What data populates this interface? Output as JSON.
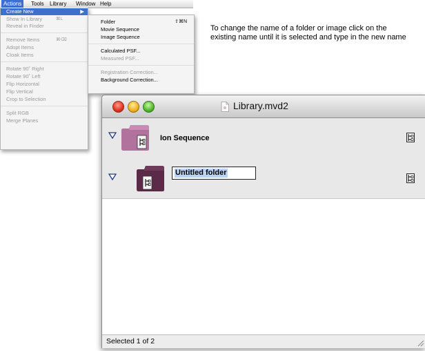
{
  "menubar": {
    "items": [
      {
        "label": "Actions",
        "active": true
      },
      {
        "label": "Tools"
      },
      {
        "label": "Library"
      },
      {
        "label": "Window"
      },
      {
        "label": "Help"
      }
    ]
  },
  "actions_menu": {
    "items": [
      {
        "label": "Create New",
        "highlighted": true,
        "arrow": "▶"
      },
      {
        "label": "Show In Library",
        "shortcut": "⌘L",
        "disabled": true
      },
      {
        "label": "Reveal in Finder",
        "disabled": true
      },
      {
        "label": "Remove Items",
        "shortcut": "⌘⌫",
        "disabled": true
      },
      {
        "label": "Adopt Items",
        "disabled": true
      },
      {
        "label": "Cloak Items",
        "disabled": true
      },
      {
        "label": "Rotate 90˚ Right",
        "disabled": true
      },
      {
        "label": "Rotate 90˚ Left",
        "disabled": true
      },
      {
        "label": "Flip Horizontal",
        "disabled": true
      },
      {
        "label": "Flip Vertical",
        "disabled": true
      },
      {
        "label": "Crop to Selection",
        "disabled": true
      },
      {
        "label": "Split RGB",
        "disabled": true
      },
      {
        "label": "Merge Planes",
        "disabled": true
      }
    ]
  },
  "create_new_submenu": {
    "items": [
      {
        "label": "Folder",
        "shortcut": "⇧⌘N"
      },
      {
        "label": "Movie Sequence"
      },
      {
        "label": "Image Sequence"
      },
      {
        "label": "Calculated PSF..."
      },
      {
        "label": "Measured PSF...",
        "disabled": true
      },
      {
        "label": "Registration Correction...",
        "disabled": true
      },
      {
        "label": "Background Correction..."
      }
    ]
  },
  "instruction": "To change the name of a folder or image click on the existing name until it is selected and type in the new name",
  "window": {
    "title": "Library.mvd2",
    "rows": [
      {
        "label": "Ion Sequence",
        "folder_color": "#b2729e"
      },
      {
        "label": "Untitled folder",
        "folder_color": "#5a2a48",
        "editing": true
      }
    ],
    "status": "Selected 1 of 2"
  }
}
